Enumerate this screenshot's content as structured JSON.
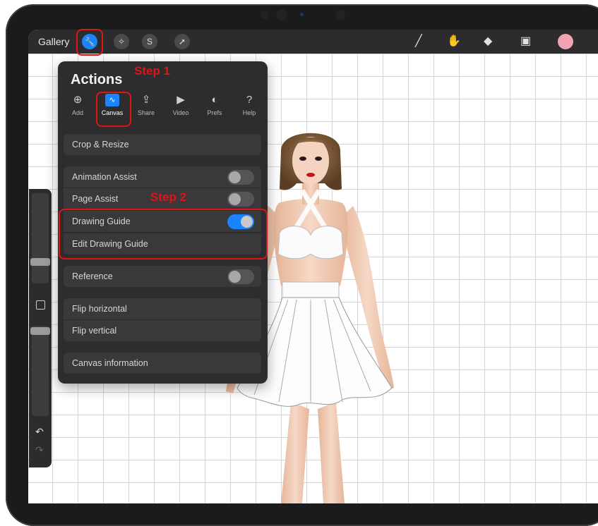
{
  "toolbar": {
    "gallery_label": "Gallery",
    "left_tools": [
      "wrench-icon",
      "magic-wand-icon",
      "selection-icon",
      "transform-arrow-icon"
    ],
    "right_tools": [
      "brush-icon",
      "smudge-icon",
      "eraser-icon",
      "layers-icon"
    ],
    "color_swatch": "#f2a3b2"
  },
  "actions": {
    "title": "Actions",
    "tabs": [
      {
        "label": "Add",
        "icon": "add-icon"
      },
      {
        "label": "Canvas",
        "icon": "canvas-icon"
      },
      {
        "label": "Share",
        "icon": "share-icon"
      },
      {
        "label": "Video",
        "icon": "video-icon"
      },
      {
        "label": "Prefs",
        "icon": "prefs-toggle-icon"
      },
      {
        "label": "Help",
        "icon": "help-icon"
      }
    ],
    "active_tab": "Canvas",
    "items": {
      "crop_resize": "Crop & Resize",
      "animation_assist": "Animation Assist",
      "page_assist": "Page Assist",
      "drawing_guide": "Drawing Guide",
      "edit_drawing_guide": "Edit Drawing Guide",
      "reference": "Reference",
      "flip_horizontal": "Flip horizontal",
      "flip_vertical": "Flip vertical",
      "canvas_information": "Canvas information"
    },
    "toggles": {
      "animation_assist": false,
      "page_assist": false,
      "drawing_guide": true,
      "reference": false
    }
  },
  "annotations": {
    "step1": "Step 1",
    "step2": "Step 2",
    "color": "#e01414"
  },
  "colors": {
    "accent": "#1a84ff",
    "panel": "#2d2d2f",
    "toolbar": "#2c2c2e"
  }
}
